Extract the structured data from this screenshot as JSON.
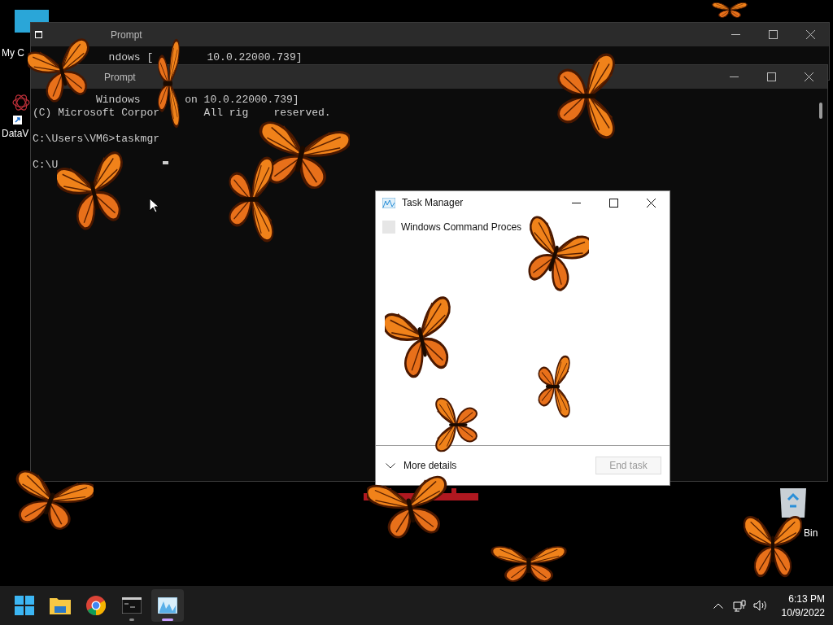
{
  "desktop": {
    "icons": [
      {
        "kind": "computer",
        "label": "My C"
      },
      {
        "kind": "shortcut",
        "label": "DataV"
      },
      {
        "kind": "bin",
        "label": "Bin"
      }
    ]
  },
  "back_console": {
    "title": "Prompt",
    "lines": [
      [
        "ndows [",
        "10.0.22000.739]"
      ]
    ]
  },
  "front_console": {
    "title": "Prompt",
    "lines": [
      [
        "Windows",
        "on 10.0.22000.739]"
      ],
      [
        "(C) Microsoft Corpor",
        "All rig",
        "reserved."
      ],
      [
        "C:\\Users\\VM6>taskmgr"
      ],
      [
        "C:\\U"
      ]
    ]
  },
  "task_manager": {
    "title": "Task Manager",
    "apps": [
      {
        "name": "Windows Command Proces"
      }
    ],
    "more_details": "More details",
    "end_task": {
      "label": "End task",
      "disabled": true
    }
  },
  "taskbar": {
    "apps": [
      {
        "kind": "start",
        "running": false,
        "selected": false
      },
      {
        "kind": "explorer",
        "running": false,
        "selected": false
      },
      {
        "kind": "chrome",
        "running": false,
        "selected": false
      },
      {
        "kind": "terminal",
        "running": true,
        "selected": false
      },
      {
        "kind": "taskmgr",
        "running": true,
        "selected": true
      }
    ],
    "clock": {
      "time": "6:13 PM",
      "date": "10/9/2022"
    }
  }
}
